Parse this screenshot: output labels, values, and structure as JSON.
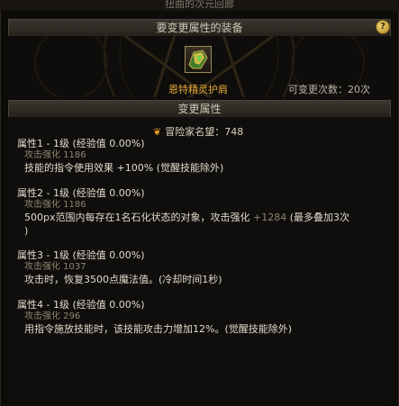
{
  "topbar": {
    "title": "扭曲的次元回廊"
  },
  "header": {
    "title": "要变更属性的装备",
    "help_label": "?"
  },
  "equipment": {
    "name": "恩特精灵护肩",
    "change_count_label": "可变更次数：20次",
    "icon": "shoulder-armor-icon"
  },
  "change_section": {
    "title": "变更属性"
  },
  "adventurer": {
    "icon": "crest-icon",
    "text": "冒险家名望：748"
  },
  "properties": [
    {
      "head": "属性1 - 1级 (经验值 0.00%)",
      "sub": "攻击强化 1186",
      "desc": "技能的指令使用效果 +100% (觉醒技能除外)"
    },
    {
      "head": "属性2 - 1级 (经验值 0.00%)",
      "sub": "攻击强化 1186",
      "desc_main": "500px范围内每存在1名石化状态的对象，攻击强化",
      "desc_bonus": " +1284",
      "desc_tail": " (最多叠加3次",
      "desc_line2": ")"
    },
    {
      "head": "属性3 - 1级 (经验值 0.00%)",
      "sub": "攻击强化 1037",
      "desc": "攻击时，恢复3500点魔法值。(冷却时间1秒)"
    },
    {
      "head": "属性4 - 1级 (经验值 0.00%)",
      "sub": "攻击强化 296",
      "desc": "用指令施放技能时，该技能攻击力增加12%。(觉醒技能除外)"
    }
  ],
  "colors": {
    "accent": "#e6a838",
    "muted": "#8e866f",
    "text": "#e0dacb"
  }
}
